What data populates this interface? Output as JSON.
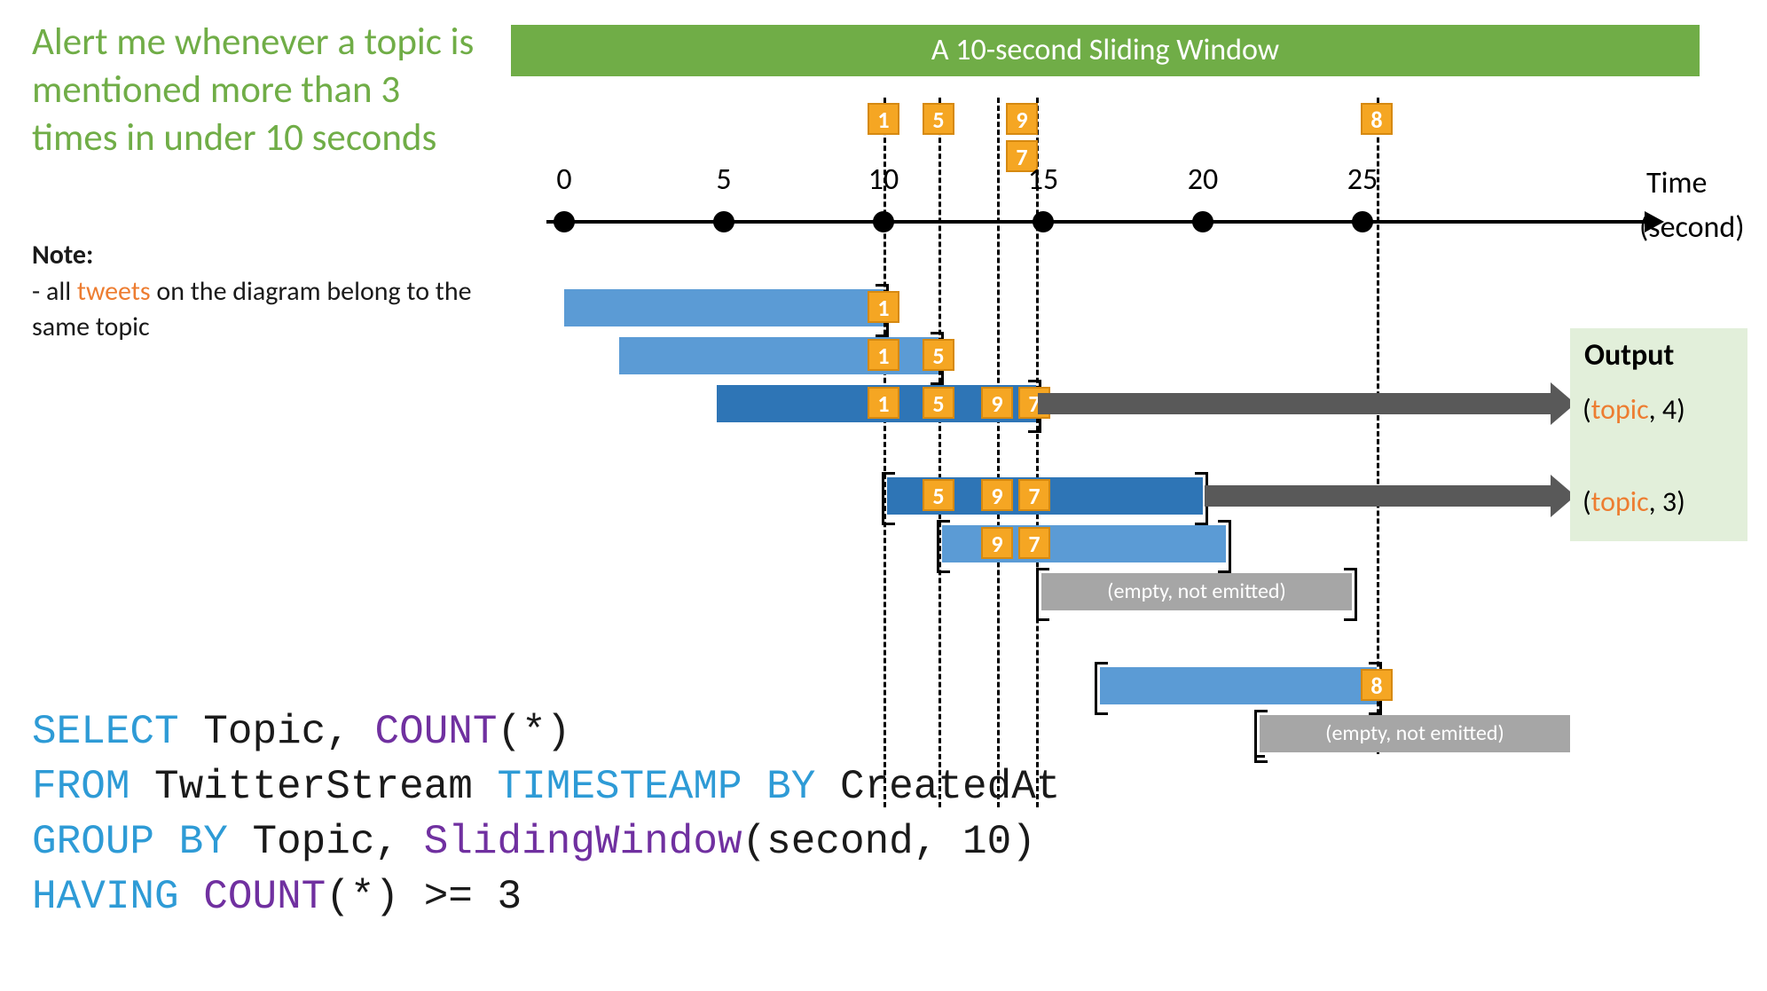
{
  "headline": "Alert me whenever a topic is mentioned more than 3 times in under 10 seconds",
  "note": {
    "label": "Note",
    "prefix": "- all ",
    "tweets_word": "tweets",
    "suffix": " on the diagram belong to the same topic"
  },
  "title_bar": "A 10-second Sliding Window",
  "axis": {
    "label": "Time",
    "units": "(second)",
    "ticks": [
      "0",
      "5",
      "10",
      "15",
      "20",
      "25"
    ]
  },
  "events_top": {
    "row1": [
      "1",
      "5",
      "9",
      "8"
    ],
    "row2_under_9": "7"
  },
  "windows": {
    "w1_tokens": [
      "1"
    ],
    "w2_tokens": [
      "1",
      "5"
    ],
    "w3_tokens": [
      "1",
      "5",
      "9",
      "7"
    ],
    "w4_tokens": [
      "5",
      "9",
      "7"
    ],
    "w5_tokens": [
      "9",
      "7"
    ],
    "w7_tokens": [
      "8"
    ],
    "empty_label": "(empty, not emitted)"
  },
  "output": {
    "title": "Output",
    "rows": [
      {
        "topic": "topic",
        "count": "4"
      },
      {
        "topic": "topic",
        "count": "3"
      }
    ]
  },
  "sql": {
    "select": "SELECT",
    "topic_count": " Topic, ",
    "count_fn": "COUNT",
    "count_args": "(*)",
    "from": "FROM",
    "stream": " TwitterStream ",
    "ts_by": "TIMESTEAMP BY",
    "created": " CreatedAt",
    "group_by": "GROUP BY",
    "group_args": " Topic, ",
    "sliding_fn": "SlidingWindow",
    "sliding_args": "(second, 10)",
    "having": "HAVING",
    "having_count_fn": "COUNT",
    "having_args": "(*) >= 3"
  },
  "colors": {
    "green": "#70ad47",
    "orange": "#ed7d31",
    "token": "#f5a623",
    "bar": "#5b9bd5",
    "bar_emit": "#2e75b6",
    "bar_empty": "#a6a6a6",
    "arrow": "#595959",
    "out_bg": "#e2efda",
    "kw_blue": "#2e9bd6",
    "kw_purple": "#7030a0"
  }
}
